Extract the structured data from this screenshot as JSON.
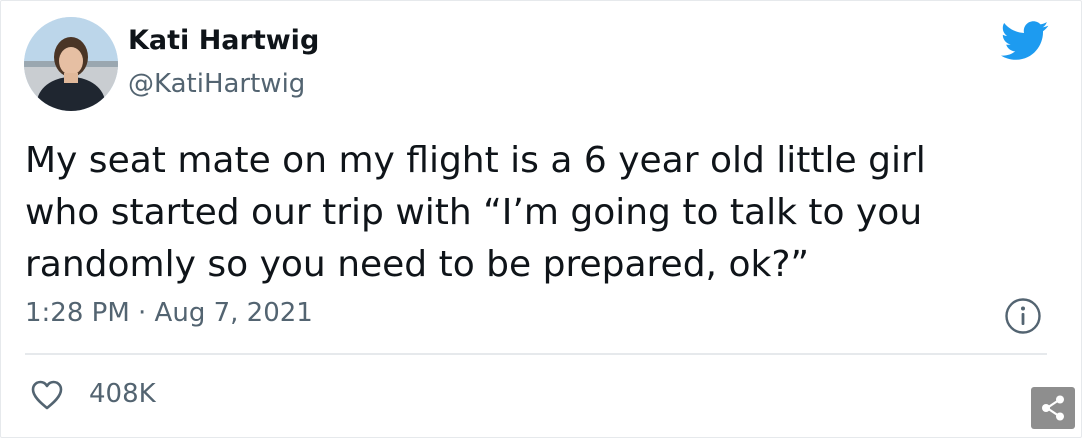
{
  "author": {
    "display_name": "Kati Hartwig",
    "handle": "@KatiHartwig"
  },
  "tweet": {
    "lines": [
      "My seat mate on my flight is a 6 year old little girl",
      "who started our trip with “I’m going to talk to you",
      "randomly so you need to be prepared, ok?”"
    ],
    "timestamp": "1:28 PM · Aug 7, 2021"
  },
  "engagement": {
    "likes": "408K"
  },
  "icons": {
    "brand": "twitter-bird-icon",
    "info": "info-icon",
    "like": "heart-icon",
    "share": "share-icon"
  },
  "colors": {
    "brand": "#1d9bf0",
    "text": "#0f1419",
    "secondary": "#536471",
    "divider": "#e6e9ec",
    "share_bg": "#8e8e8e"
  }
}
